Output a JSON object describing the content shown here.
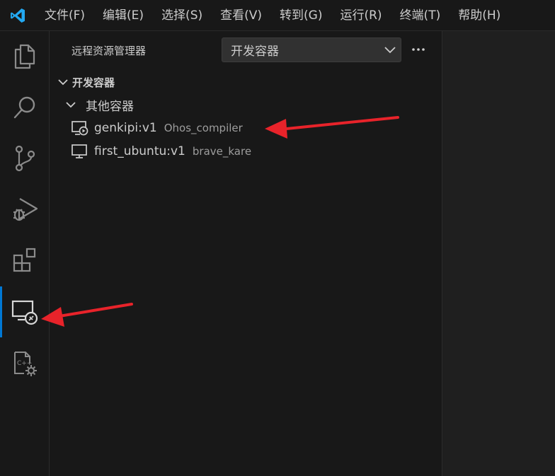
{
  "menu": [
    "文件(F)",
    "编辑(E)",
    "选择(S)",
    "查看(V)",
    "转到(G)",
    "运行(R)",
    "终端(T)",
    "帮助(H)"
  ],
  "activity_bar": [
    {
      "icon": "files-icon"
    },
    {
      "icon": "search-icon"
    },
    {
      "icon": "source-control-icon"
    },
    {
      "icon": "run-debug-icon"
    },
    {
      "icon": "extensions-icon"
    },
    {
      "icon": "remote-explorer-icon",
      "active": true
    },
    {
      "icon": "cpp-settings-icon"
    }
  ],
  "sidebar": {
    "title": "远程资源管理器",
    "selector_value": "开发容器",
    "section": "开发容器",
    "group": "其他容器",
    "items": [
      {
        "name": "genkipi:v1",
        "description": "Ohos_compiler",
        "status": "running"
      },
      {
        "name": "first_ubuntu:v1",
        "description": "brave_kare",
        "status": "stopped"
      }
    ]
  },
  "colors": {
    "accent": "#0078d4",
    "logo": "#23a9f2",
    "annotation_arrow": "#e8232a"
  }
}
